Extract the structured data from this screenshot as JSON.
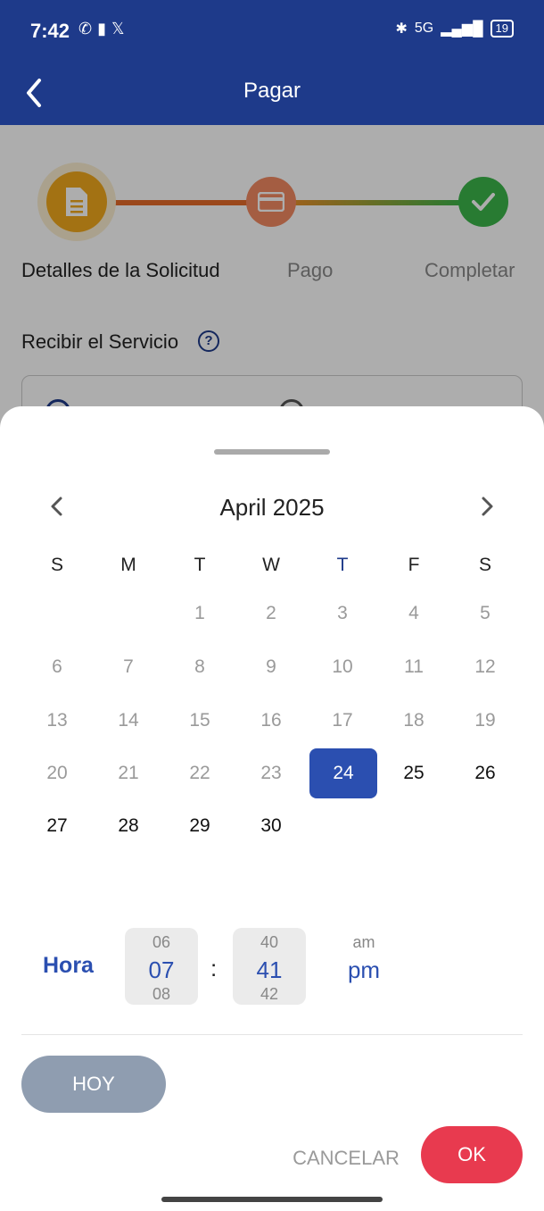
{
  "status_bar": {
    "time": "7:42",
    "battery": "19",
    "network": "5G"
  },
  "app_bar": {
    "title": "Pagar"
  },
  "stepper": {
    "steps": [
      "Detalles de la Solicitud",
      "Pago",
      "Completar"
    ]
  },
  "service": {
    "title": "Recibir el Servicio"
  },
  "date_picker": {
    "month_title": "April 2025",
    "weekdays": [
      "S",
      "M",
      "T",
      "W",
      "T",
      "F",
      "S"
    ],
    "days": [
      "1",
      "2",
      "3",
      "4",
      "5",
      "6",
      "7",
      "8",
      "9",
      "10",
      "11",
      "12",
      "13",
      "14",
      "15",
      "16",
      "17",
      "18",
      "19",
      "20",
      "21",
      "22",
      "23",
      "24",
      "25",
      "26",
      "27",
      "28",
      "29",
      "30"
    ],
    "selected_day": "24"
  },
  "time_picker": {
    "label": "Hora",
    "hour": {
      "prev": "06",
      "current": "07",
      "next": "08"
    },
    "minute": {
      "prev": "40",
      "current": "41",
      "next": "42"
    },
    "separator": ":",
    "ampm": {
      "other": "am",
      "current": "pm"
    }
  },
  "buttons": {
    "today": "HOY",
    "cancel": "CANCELAR",
    "ok": "OK"
  },
  "colors": {
    "primary": "#1e3a8a",
    "accent": "#2b4fb0",
    "ok": "#e83a4f"
  }
}
